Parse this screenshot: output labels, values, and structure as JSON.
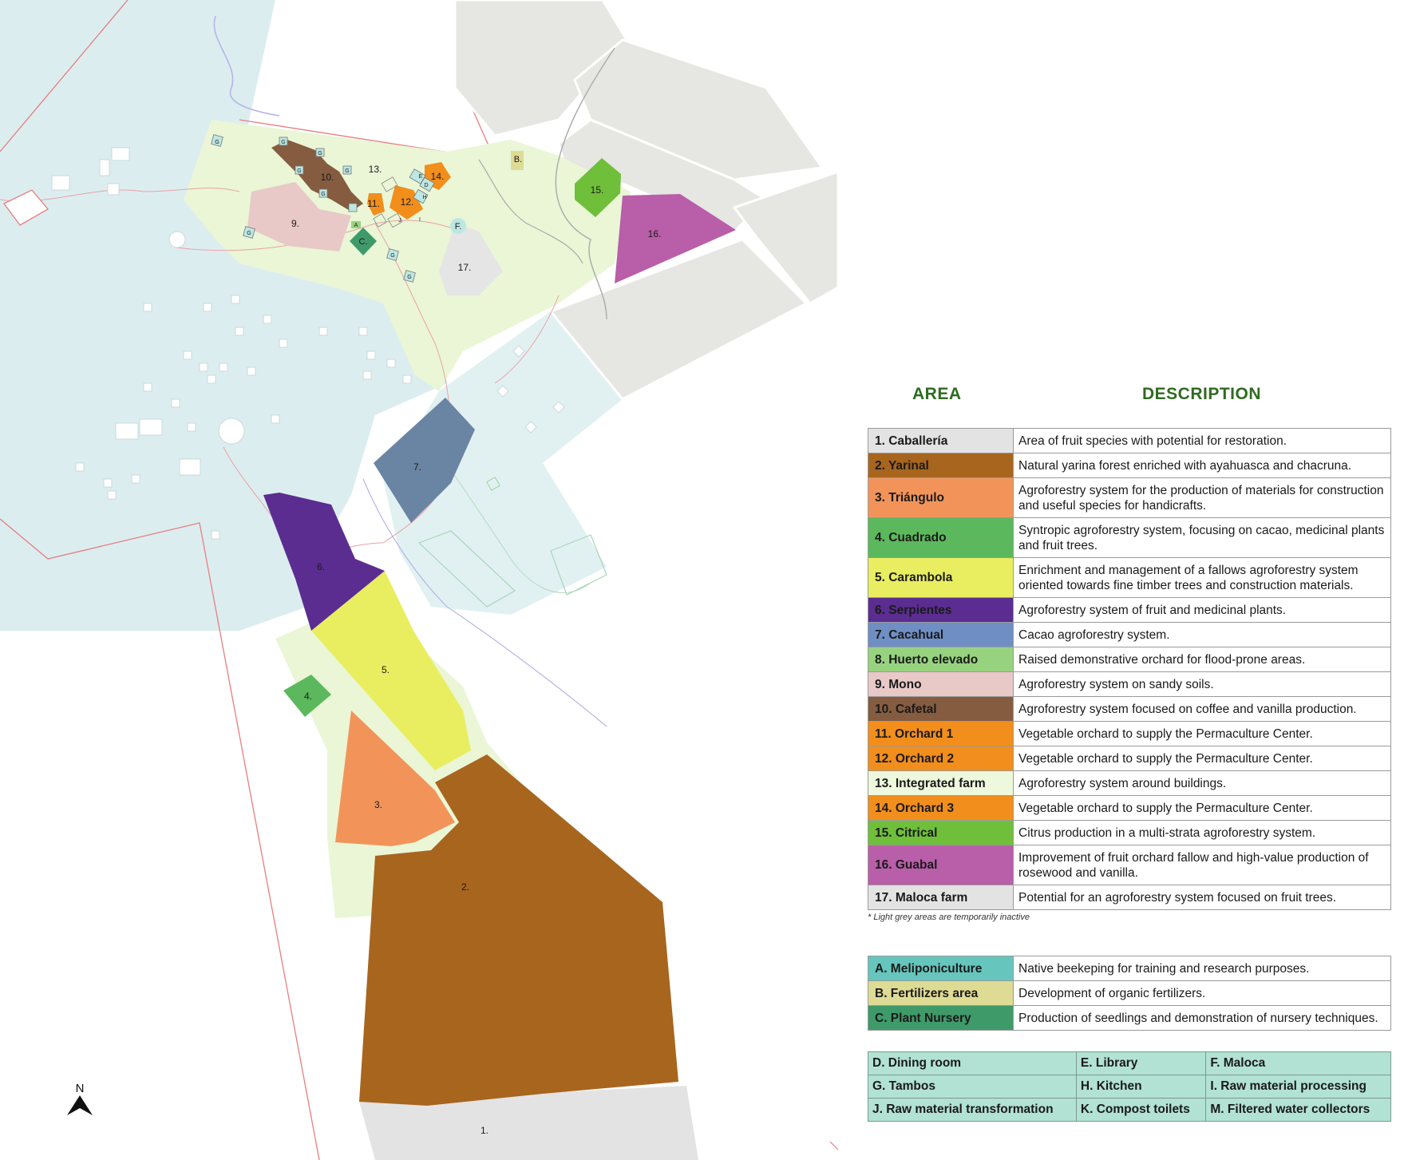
{
  "map": {
    "zone_labels": [
      "1.",
      "2.",
      "3.",
      "4.",
      "5.",
      "6.",
      "7.",
      "9.",
      "10.",
      "11.",
      "12.",
      "13.",
      "14.",
      "15.",
      "16.",
      "17."
    ],
    "poi_labels": [
      "B.",
      "C.",
      "F.",
      "A",
      "E",
      "D",
      "H",
      "I",
      "J",
      "G"
    ],
    "north_label": "N"
  },
  "legend": {
    "area_header": "AREA",
    "description_header": "DESCRIPTION",
    "areas": [
      {
        "name": "1. Caballería",
        "description": "Area of fruit species with potential for restoration.",
        "color": "#e3e3e3",
        "text_color": "#1a1a1a"
      },
      {
        "name": "2. Yarinal",
        "description": "Natural yarina forest enriched with ayahuasca and chacruna.",
        "color": "#a8651e",
        "text_color": "#1a1a1a"
      },
      {
        "name": "3. Triángulo",
        "description": "Agroforestry system for the production of materials for construction and useful species for handicrafts.",
        "color": "#f2945a",
        "text_color": "#1a1a1a"
      },
      {
        "name": "4. Cuadrado",
        "description": "Syntropic agroforestry system, focusing on cacao, medicinal plants and fruit trees.",
        "color": "#5cb85c",
        "text_color": "#1a1a1a"
      },
      {
        "name": "5. Carambola",
        "description": "Enrichment and management of a fallows agroforestry system oriented towards fine timber trees and construction materials.",
        "color": "#e9ee60",
        "text_color": "#1a1a1a"
      },
      {
        "name": "6. Serpientes",
        "description": "Agroforestry system of fruit and medicinal plants.",
        "color": "#5b2d91",
        "text_color": "#1a1a1a"
      },
      {
        "name": "7. Cacahual",
        "description": "Cacao agroforestry system.",
        "color": "#6f8fc4",
        "text_color": "#1a1a1a"
      },
      {
        "name": "8. Huerto elevado",
        "description": "Raised demonstrative orchard for flood-prone areas.",
        "color": "#97d37f",
        "text_color": "#1a1a1a"
      },
      {
        "name": "9. Mono",
        "description": "Agroforestry system on sandy soils.",
        "color": "#e8c9c7",
        "text_color": "#1a1a1a"
      },
      {
        "name": "10. Cafetal",
        "description": "Agroforestry system focused on coffee and vanilla production.",
        "color": "#855c40",
        "text_color": "#1a1a1a"
      },
      {
        "name": "11. Orchard 1",
        "description": "Vegetable orchard to supply the Permaculture Center.",
        "color": "#f28e1c",
        "text_color": "#1a1a1a"
      },
      {
        "name": "12. Orchard 2",
        "description": "Vegetable orchard to supply the Permaculture Center.",
        "color": "#f28e1c",
        "text_color": "#1a1a1a"
      },
      {
        "name": "13. Integrated farm",
        "description": "Agroforestry system around buildings.",
        "color": "#eef8dc",
        "text_color": "#1a1a1a"
      },
      {
        "name": "14. Orchard 3",
        "description": "Vegetable orchard to supply the Permaculture Center.",
        "color": "#f28e1c",
        "text_color": "#1a1a1a"
      },
      {
        "name": "15. Citrical",
        "description": "Citrus production in a multi-strata agroforestry system.",
        "color": "#6fbf3a",
        "text_color": "#1a1a1a"
      },
      {
        "name": "16. Guabal",
        "description": "Improvement of fruit orchard fallow and high-value production of rosewood and vanilla.",
        "color": "#b95ea8",
        "text_color": "#1a1a1a"
      },
      {
        "name": "17. Maloca farm",
        "description": "Potential for an agroforestry system focused on fruit trees.",
        "color": "#e3e3e3",
        "text_color": "#1a1a1a"
      }
    ],
    "note": "* Light grey areas are temporarily inactive",
    "points": [
      {
        "name": "A. Meliponiculture",
        "description": "Native beekeping for training and research purposes.",
        "color": "#66c6bd"
      },
      {
        "name": "B. Fertilizers area",
        "description": "Development of organic fertilizers.",
        "color": "#dedb94"
      },
      {
        "name": "C. Plant Nursery",
        "description": "Production of seedlings and demonstration of nursery techniques.",
        "color": "#3f9a6a"
      }
    ],
    "facilities": [
      [
        "D. Dining room",
        "E. Library",
        "F. Maloca"
      ],
      [
        "G. Tambos",
        "H. Kitchen",
        "I. Raw material processing"
      ],
      [
        "J. Raw material transformation",
        "K. Compost toilets",
        "M. Filtered water collectors"
      ]
    ]
  }
}
